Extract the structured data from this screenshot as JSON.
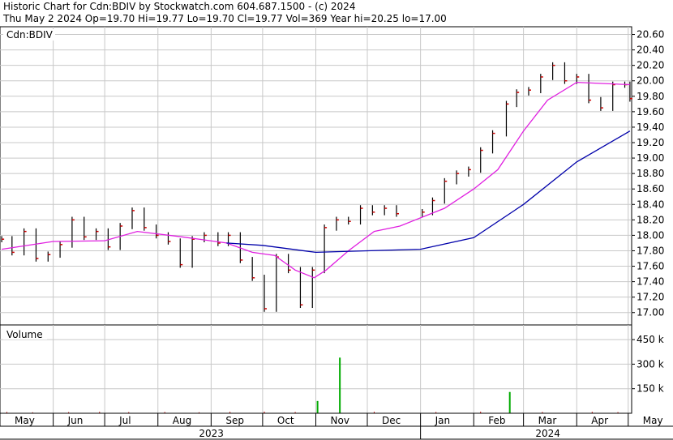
{
  "header": {
    "line1": "Historic Chart for Cdn:BDIV by Stockwatch.com 604.687.1500 - (c) 2024",
    "line2": "Thu May  2 2024  Op=19.70  Hi=19.77  Lo=19.70  Cl=19.77  Vol=369  Year hi=20.25  lo=17.00"
  },
  "chart_data": [
    {
      "type": "line",
      "panel": "price",
      "label": "Cdn:BDIV",
      "ylim": [
        16.84,
        20.7
      ],
      "yticks": [
        17.0,
        17.2,
        17.4,
        17.6,
        17.8,
        18.0,
        18.2,
        18.4,
        18.6,
        18.8,
        19.0,
        19.2,
        19.4,
        19.6,
        19.8,
        20.0,
        20.2,
        20.4,
        20.6
      ],
      "ytick_labels": [
        "17.00",
        "17.20",
        "17.40",
        "17.60",
        "17.80",
        "18.00",
        "18.20",
        "18.40",
        "18.60",
        "18.80",
        "19.00",
        "19.20",
        "19.40",
        "19.60",
        "19.80",
        "20.00",
        "20.20",
        "20.40",
        "20.60"
      ],
      "grid": true,
      "x_months": [
        "May",
        "Jun",
        "Jul",
        "Aug",
        "Sep",
        "Oct",
        "Nov",
        "Dec",
        "Jan",
        "Feb",
        "Mar",
        "Apr",
        "May"
      ],
      "x_years": [
        "2023",
        "2024"
      ],
      "series": [
        {
          "style": "ohlc-bars",
          "color": "#000000",
          "close_color": "#cc0000",
          "points": [
            [
              "2023-05-02",
              17.95
            ],
            [
              "2023-05-08",
              17.78
            ],
            [
              "2023-05-15",
              18.05
            ],
            [
              "2023-05-22",
              17.7
            ],
            [
              "2023-05-29",
              17.75
            ],
            [
              "2023-06-05",
              17.88
            ],
            [
              "2023-06-12",
              18.2
            ],
            [
              "2023-06-19",
              17.98
            ],
            [
              "2023-06-26",
              18.05
            ],
            [
              "2023-07-03",
              17.85
            ],
            [
              "2023-07-10",
              18.12
            ],
            [
              "2023-07-17",
              18.32
            ],
            [
              "2023-07-24",
              18.1
            ],
            [
              "2023-07-31",
              18.0
            ],
            [
              "2023-08-07",
              17.92
            ],
            [
              "2023-08-14",
              17.62
            ],
            [
              "2023-08-21",
              17.95
            ],
            [
              "2023-08-28",
              18.0
            ],
            [
              "2023-09-05",
              17.9
            ],
            [
              "2023-09-11",
              18.0
            ],
            [
              "2023-09-18",
              17.68
            ],
            [
              "2023-09-25",
              17.45
            ],
            [
              "2023-10-02",
              17.05
            ],
            [
              "2023-10-09",
              17.72
            ],
            [
              "2023-10-16",
              17.55
            ],
            [
              "2023-10-23",
              17.1
            ],
            [
              "2023-10-30",
              17.55
            ],
            [
              "2023-11-06",
              18.1
            ],
            [
              "2023-11-13",
              18.2
            ],
            [
              "2023-11-20",
              18.18
            ],
            [
              "2023-11-27",
              18.35
            ],
            [
              "2023-12-04",
              18.3
            ],
            [
              "2023-12-11",
              18.35
            ],
            [
              "2023-12-18",
              18.28
            ],
            [
              "2024-01-02",
              18.3
            ],
            [
              "2024-01-08",
              18.45
            ],
            [
              "2024-01-15",
              18.7
            ],
            [
              "2024-01-22",
              18.8
            ],
            [
              "2024-01-29",
              18.85
            ],
            [
              "2024-02-05",
              19.1
            ],
            [
              "2024-02-12",
              19.32
            ],
            [
              "2024-02-20",
              19.7
            ],
            [
              "2024-02-26",
              19.85
            ],
            [
              "2024-03-04",
              19.88
            ],
            [
              "2024-03-11",
              20.05
            ],
            [
              "2024-03-18",
              20.2
            ],
            [
              "2024-03-25",
              20.0
            ],
            [
              "2024-04-01",
              20.05
            ],
            [
              "2024-04-08",
              19.75
            ],
            [
              "2024-04-15",
              19.65
            ],
            [
              "2024-04-22",
              19.95
            ],
            [
              "2024-04-29",
              19.95
            ],
            [
              "2024-05-02",
              19.77
            ]
          ]
        },
        {
          "style": "moving-average",
          "color": "#e020e0",
          "points": [
            [
              "2023-05-02",
              17.82
            ],
            [
              "2023-06-01",
              17.92
            ],
            [
              "2023-07-01",
              17.93
            ],
            [
              "2023-07-20",
              18.05
            ],
            [
              "2023-08-15",
              17.98
            ],
            [
              "2023-09-10",
              17.9
            ],
            [
              "2023-09-25",
              17.78
            ],
            [
              "2023-10-08",
              17.74
            ],
            [
              "2023-10-20",
              17.55
            ],
            [
              "2023-10-31",
              17.45
            ],
            [
              "2023-11-07",
              17.55
            ],
            [
              "2023-11-20",
              17.8
            ],
            [
              "2023-12-05",
              18.05
            ],
            [
              "2023-12-20",
              18.12
            ],
            [
              "2024-01-15",
              18.35
            ],
            [
              "2024-02-01",
              18.6
            ],
            [
              "2024-02-15",
              18.85
            ],
            [
              "2024-03-01",
              19.35
            ],
            [
              "2024-03-15",
              19.75
            ],
            [
              "2024-04-01",
              19.98
            ],
            [
              "2024-05-02",
              19.95
            ]
          ]
        },
        {
          "style": "moving-average",
          "color": "#0000aa",
          "points": [
            [
              "2023-09-10",
              17.9
            ],
            [
              "2023-10-01",
              17.87
            ],
            [
              "2023-11-01",
              17.78
            ],
            [
              "2023-12-01",
              17.8
            ],
            [
              "2024-01-01",
              17.82
            ],
            [
              "2024-02-01",
              17.97
            ],
            [
              "2024-03-01",
              18.4
            ],
            [
              "2024-04-01",
              18.95
            ],
            [
              "2024-05-02",
              19.35
            ]
          ]
        }
      ]
    },
    {
      "type": "bar",
      "panel": "volume",
      "title": "Volume",
      "ylim": [
        0,
        500000
      ],
      "yticks": [
        150000,
        300000,
        450000
      ],
      "ytick_labels": [
        "150 k",
        "300 k",
        "450 k"
      ],
      "grid": true,
      "bars": [
        {
          "x": "2023-11-02",
          "value": 75000,
          "color": "#00aa00"
        },
        {
          "x": "2023-11-15",
          "value": 340000,
          "color": "#00aa00"
        },
        {
          "x": "2024-02-22",
          "value": 130000,
          "color": "#00aa00"
        }
      ],
      "baseline": [
        [
          "2023-05-05",
          8000
        ],
        [
          "2023-05-20",
          6000
        ],
        [
          "2023-06-10",
          7000
        ],
        [
          "2023-06-28",
          9000
        ],
        [
          "2023-07-15",
          7000
        ],
        [
          "2023-08-05",
          8000
        ],
        [
          "2023-08-25",
          6000
        ],
        [
          "2023-09-12",
          9000
        ],
        [
          "2023-10-02",
          10000
        ],
        [
          "2023-10-20",
          8000
        ],
        [
          "2023-12-05",
          9000
        ],
        [
          "2024-01-10",
          8000
        ],
        [
          "2024-02-05",
          10000
        ],
        [
          "2024-03-12",
          8000
        ],
        [
          "2024-04-10",
          9000
        ],
        [
          "2024-04-25",
          7000
        ]
      ],
      "baseline_color": "#cc0000"
    }
  ]
}
